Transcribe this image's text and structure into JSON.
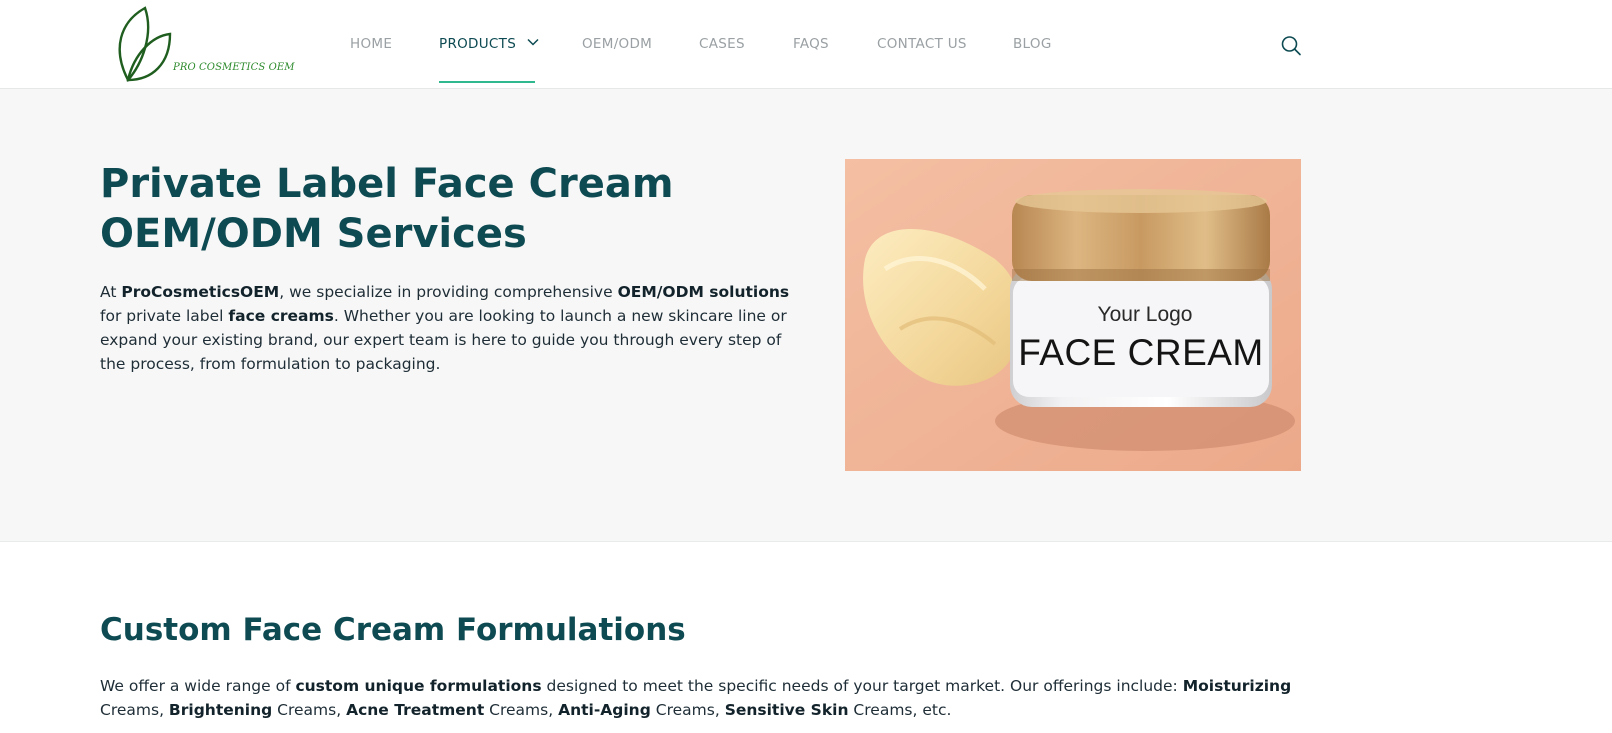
{
  "header": {
    "logo_text": "PRO COSMETICS OEM",
    "nav": [
      {
        "label": "HOME"
      },
      {
        "label": "PRODUCTS"
      },
      {
        "label": "OEM/ODM"
      },
      {
        "label": "CASES"
      },
      {
        "label": "FAQS"
      },
      {
        "label": "CONTACT US"
      },
      {
        "label": "BLOG"
      }
    ],
    "active_nav": "PRODUCTS",
    "search_icon": "search-icon",
    "accent_color": "#2fb88e"
  },
  "hero": {
    "title_line1": "Private Label Face Cream",
    "title_line2": "OEM/ODM Services",
    "p1": "At ",
    "b1": "ProCosmeticsOEM",
    "p2": ", we specialize in providing comprehensive ",
    "b2": "OEM/ODM solutions",
    "p3": " for private label ",
    "b3": "face creams",
    "p4": ". Whether you are looking to launch a new skincare line or expand your existing brand, our expert team is here to guide you through every step of the process, from formulation to packaging.",
    "image": {
      "label_top": "Your Logo",
      "label_main": "FACE CREAM"
    }
  },
  "formulations": {
    "title": "Custom Face Cream Formulations",
    "t1": "We offer a wide range of ",
    "b1": "custom unique formulations",
    "t2": " designed to meet the specific needs of your target market. Our offerings include: ",
    "b2": "Moisturizing",
    "t3": " Creams, ",
    "b3": "Brightening",
    "t4": " Creams, ",
    "b4": "Acne Treatment",
    "t5": " Creams, ",
    "b5": "Anti-Aging",
    "t6": " Creams, ",
    "b6": "Sensitive Skin",
    "t7": " Creams, etc."
  },
  "colors": {
    "heading": "#0d4a52",
    "hero_bg": "#f7f7f7",
    "logo_green": "#1f6b1f"
  }
}
